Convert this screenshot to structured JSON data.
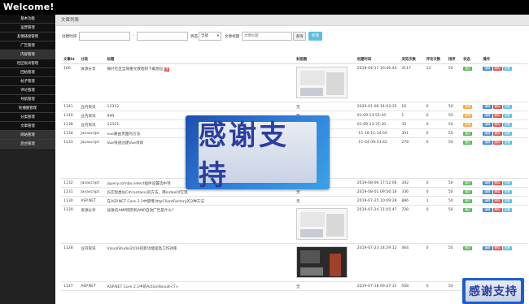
{
  "app": {
    "title": "Welcome!"
  },
  "sidebar": {
    "items": [
      {
        "label": "基本功能",
        "style": "dark"
      },
      {
        "label": "运营管理",
        "style": "dark"
      },
      {
        "label": "友情链接管理",
        "style": "dark"
      },
      {
        "label": "广告管理",
        "style": "dark"
      },
      {
        "label": "内容管理",
        "style": "sub"
      },
      {
        "label": "社区板块管理",
        "style": "dark"
      },
      {
        "label": "回帖管理",
        "style": "dark"
      },
      {
        "label": "帖子管理",
        "style": "dark"
      },
      {
        "label": "评论管理",
        "style": "dark"
      },
      {
        "label": "导航管理",
        "style": "dark"
      },
      {
        "label": "轮播图管理",
        "style": "dark"
      },
      {
        "label": "分类管理",
        "style": "dark"
      },
      {
        "label": "文章管理",
        "style": "dark"
      },
      {
        "label": "网站管理",
        "style": "sub"
      },
      {
        "label": "后台管理",
        "style": "sub"
      }
    ]
  },
  "page": {
    "title": "文章列表"
  },
  "filter": {
    "created_label": "创建时间",
    "date_from_value": "",
    "date_to_value": "",
    "dash": "-",
    "status_label": "状态",
    "status_selected": "全部",
    "title_label": "文章标题",
    "title_placeholder": "文章标题",
    "search_label": "查询",
    "add_label": "新增"
  },
  "table": {
    "headers": [
      "文章Id",
      "分类",
      "标题",
      "封面图",
      "创建时间",
      "浏览次数",
      "评论次数",
      "排序",
      "状态",
      "操作"
    ],
    "rows": [
      {
        "id": "106",
        "category": "资源分享",
        "title": "微叶社区全保重文教程附下载地址",
        "tag": "荐",
        "cover": "doc",
        "created": "2018-04-17 16:46:44",
        "views": "3117",
        "comments": "13",
        "sort": "50",
        "status": "通过",
        "status_color": "green",
        "kind": "img"
      },
      {
        "id": "1141",
        "category": "业内资讯",
        "title": "12312",
        "tag": "",
        "cover": "无",
        "created": "2020-01-09 14:03:35",
        "views": "16",
        "comments": "0",
        "sort": "50",
        "status": "待审",
        "status_color": "orange",
        "kind": "r"
      },
      {
        "id": "1140",
        "category": "业内资讯",
        "title": "qqq",
        "tag": "",
        "cover": "无",
        "created": "01-09 13:55:45",
        "views": "1",
        "comments": "0",
        "sort": "50",
        "status": "待审",
        "status_color": "orange",
        "kind": "r"
      },
      {
        "id": "1138",
        "category": "业内资讯",
        "title": "12321",
        "tag": "",
        "cover": "无",
        "created": "01-09 13:37:30",
        "views": "35",
        "comments": "0",
        "sort": "50",
        "status": "待审",
        "status_color": "orange",
        "kind": "r"
      },
      {
        "id": "1134",
        "category": "Javascript",
        "title": "vue路由页面的方法",
        "tag": "",
        "cover": "无",
        "created": "-11-18 11:34:50",
        "views": "391",
        "comments": "0",
        "sort": "50",
        "status": "通过",
        "status_color": "green",
        "kind": "r"
      },
      {
        "id": "1133",
        "category": "Javascript",
        "title": "Vue快速创建Vue项目",
        "tag": "",
        "cover": "无",
        "created": "-11-04 09:53:42",
        "views": "278",
        "comments": "0",
        "sort": "50",
        "status": "通过",
        "status_color": "green",
        "kind": "tall"
      },
      {
        "id": "1132",
        "category": "Javascript",
        "title": "jquery.combo.select插件设置选中项",
        "tag": "",
        "cover": "无",
        "created": "2019-08-06 17:52:06",
        "views": "342",
        "comments": "0",
        "sort": "50",
        "status": "通过",
        "status_color": "green",
        "kind": "r"
      },
      {
        "id": "1131",
        "category": "Javascript",
        "title": "JS实现类似C#contains的方法，用indexOf实现",
        "tag": "",
        "cover": "无",
        "created": "2019-08-01 09:56:18",
        "views": "336",
        "comments": "0",
        "sort": "50",
        "status": "通过",
        "status_color": "green",
        "kind": "r"
      },
      {
        "id": "1130",
        "category": "ASP.NET",
        "title": "在ASP.NET Core 2.1中使用HttpClientFactory的3种方法",
        "tag": "",
        "cover": "无",
        "created": "2019-07-25 10:09:28",
        "views": "886",
        "comments": "1",
        "sort": "50",
        "status": "通过",
        "status_color": "green",
        "kind": "r"
      },
      {
        "id": "1129",
        "category": "资源分享",
        "title": "谷歌的AMP网页和AMP自动广告是什么?",
        "tag": "",
        "cover": "doc",
        "created": "2019-07-24 11:05:47",
        "views": "728",
        "comments": "0",
        "sort": "50",
        "status": "通过",
        "status_color": "green",
        "kind": "img"
      },
      {
        "id": "1128",
        "category": "业内资讯",
        "title": "VisualStudio2019的新功能提高工作效率",
        "tag": "",
        "cover": "photo",
        "created": "2019-07-23 14:29:12",
        "views": "464",
        "comments": "0",
        "sort": "50",
        "status": "通过",
        "status_color": "green",
        "kind": "img"
      },
      {
        "id": "1127",
        "category": "ASP.NET",
        "title": "ASP.NET Core 2.1中的ActionResult<T>",
        "tag": "",
        "cover": "无",
        "created": "2019-07-18 09:27:31",
        "views": "508",
        "comments": "0",
        "sort": "50",
        "status": "通过",
        "status_color": "green",
        "kind": "r"
      }
    ],
    "actions": [
      "编辑",
      "删除",
      "查看"
    ]
  },
  "overlay": {
    "text": "感谢支持"
  }
}
